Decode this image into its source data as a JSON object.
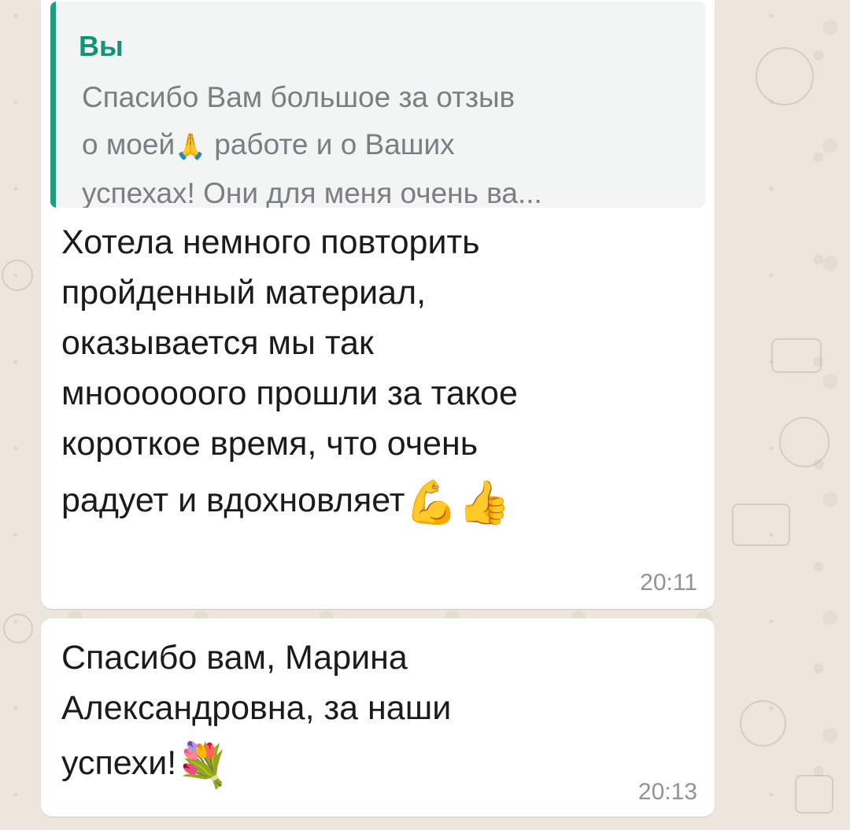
{
  "conversation": {
    "message1": {
      "quote": {
        "sender": "Вы",
        "line1": "Спасибо Вам большое за отзыв",
        "line2_before": "о моей",
        "line2_emoji": "🙏",
        "line2_after": " работе и о Ваших",
        "line3": "успехах! Они для меня очень ва..."
      },
      "text_lines": [
        "Хотела немного повторить",
        "пройденный материал,",
        "оказывается мы так",
        "мноооооого прошли за такое",
        "короткое время, что очень",
        "радует и вдохновляет"
      ],
      "emoji_muscle": "💪",
      "emoji_thumbs": "👍",
      "time": "20:11"
    },
    "message2": {
      "text_lines": [
        "Спасибо вам,  Марина",
        "Александровна, за наши",
        "успехи!"
      ],
      "emoji_bouquet": "💐",
      "time": "20:13"
    }
  },
  "colors": {
    "wallpaper": "#ece6dc",
    "bubble": "#ffffff",
    "quote_bar": "#1f9d82",
    "quote_sender": "#0f9478",
    "quote_text": "#7a7f82",
    "message_text": "#1b1b1b",
    "timestamp": "#8f9499"
  },
  "icons": {
    "pray": "pray-emoji-icon",
    "muscle": "flexed-biceps-emoji-icon",
    "thumbs": "thumbs-up-emoji-icon",
    "bouquet": "bouquet-emoji-icon"
  }
}
